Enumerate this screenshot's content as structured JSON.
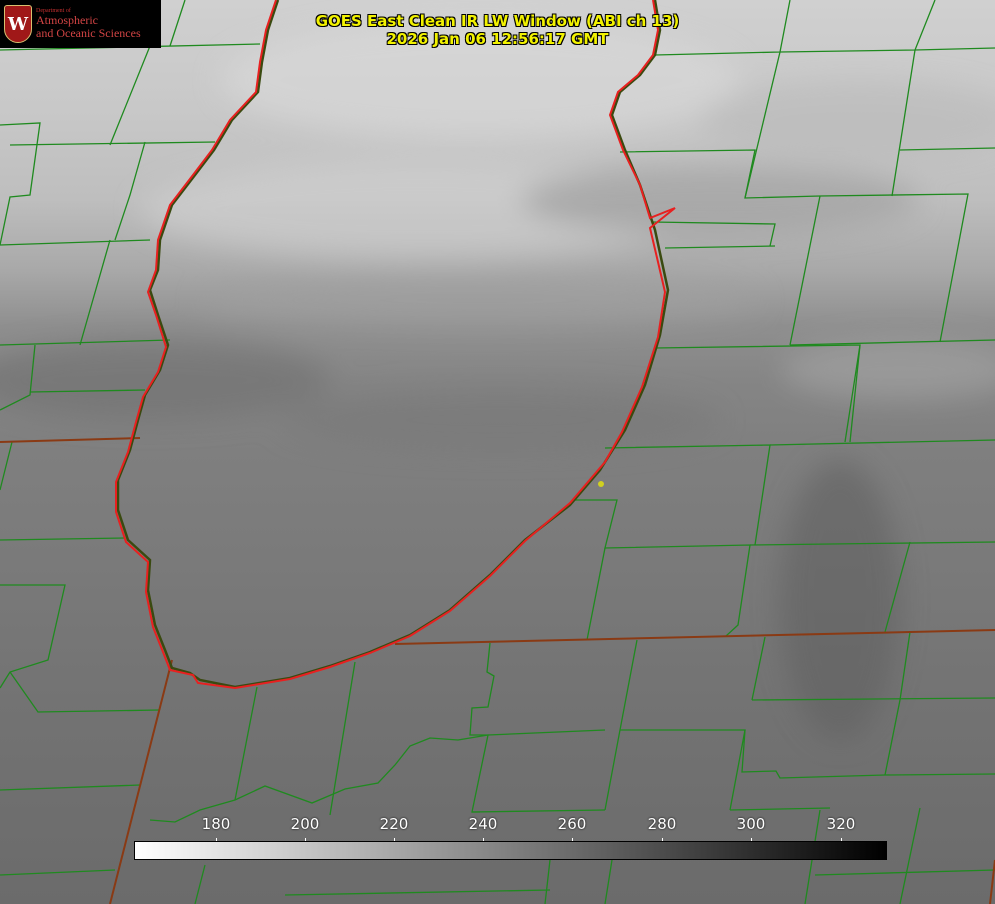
{
  "header": {
    "title": "GOES East Clean IR LW Window (ABI ch 13)",
    "timestamp": "2026 Jan 06 12:56:17 GMT"
  },
  "logo": {
    "crest_letter": "W",
    "department": "Department of",
    "line1": "Atmospheric",
    "line2": "and Oceanic Sciences"
  },
  "colorbar": {
    "ticks": [
      "180",
      "200",
      "220",
      "240",
      "260",
      "280",
      "300",
      "320"
    ],
    "colormap": [
      "#ffffff",
      "#000000"
    ]
  },
  "colors": {
    "lake_outline": "#e82020",
    "county_lines": "#1f8a1f",
    "state_lines": "#8a3a14",
    "title_text": "#f2f200",
    "marker": "#d0d020"
  }
}
